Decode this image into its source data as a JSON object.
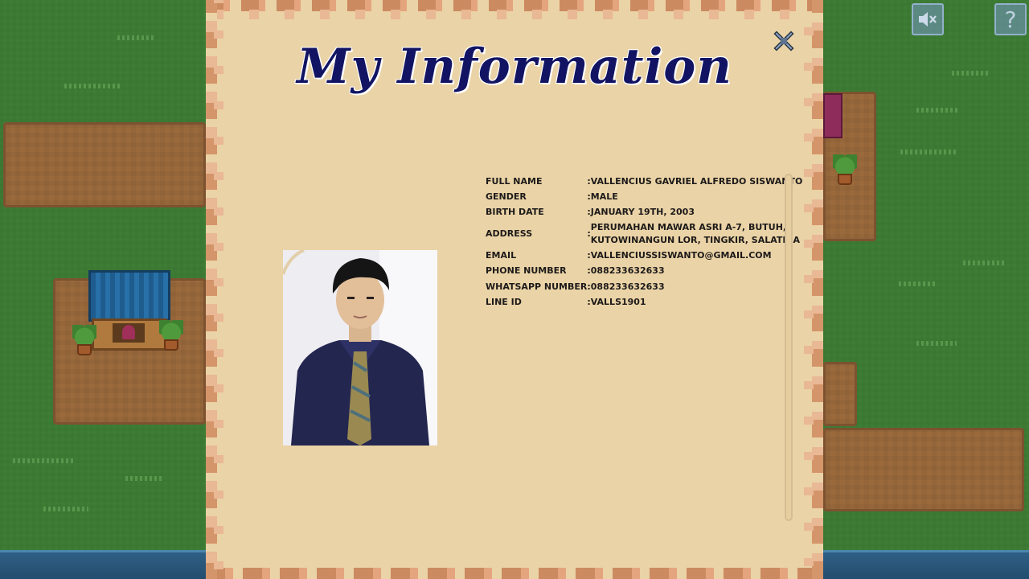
{
  "title": "My Information",
  "close_icon": "close-x-icon",
  "buttons": {
    "mute_icon": "speaker-muted-icon",
    "help_glyph": "?"
  },
  "info": {
    "rows": [
      {
        "label": "Full Name",
        "value": "Vallencius Gavriel Alfredo Siswanto"
      },
      {
        "label": "Gender",
        "value": "Male"
      },
      {
        "label": "Birth Date",
        "value": "January 19th, 2003"
      },
      {
        "label": "Address",
        "value": "Perumahan Mawar Asri A-7, Butuh, Kutowinangun Lor, Tingkir, Salatiga"
      },
      {
        "label": "Email",
        "value": "vallenciussiswanto@gmail.com"
      },
      {
        "label": "Phone Number",
        "value": "088233632633"
      },
      {
        "label": "WhatsApp Number",
        "value": "088233632633"
      },
      {
        "label": "Line ID",
        "value": "valls1901"
      }
    ],
    "separator": ":"
  },
  "colors": {
    "panel": "#ead3a6",
    "border": "#cc8a60",
    "title": "#121463",
    "grass": "#3d7d35",
    "dirt": "#9b6a3c",
    "water": "#2f5f85"
  }
}
